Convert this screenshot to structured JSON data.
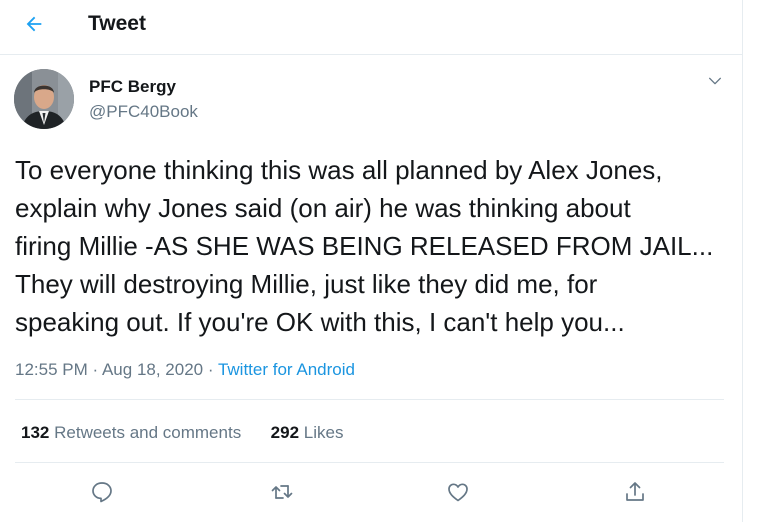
{
  "header": {
    "title": "Tweet"
  },
  "tweet": {
    "author": {
      "name": "PFC Bergy",
      "handle": "@PFC40Book"
    },
    "text_lines": [
      "To everyone thinking this was all planned by Alex Jones,",
      "explain why Jones said (on air) he was thinking about",
      "firing Millie -AS SHE WAS BEING RELEASED FROM JAIL...",
      "They will destroying Millie, just like they did me, for",
      "speaking out. If you're OK with this, I can't help you..."
    ],
    "time": "12:55 PM",
    "separator": "·",
    "date": "Aug 18, 2020",
    "source": "Twitter for Android",
    "stats": {
      "retweets_count": "132",
      "retweets_label": "Retweets and comments",
      "likes_count": "292",
      "likes_label": "Likes"
    }
  },
  "icons": {
    "back": "arrow-left-icon",
    "more": "chevron-down-icon",
    "reply": "speech-bubble-icon",
    "retweet": "retweet-icon",
    "like": "heart-icon",
    "share": "share-upload-icon"
  },
  "colors": {
    "accent": "#1da1f2",
    "link": "#1b95e0",
    "text_primary": "#14171a",
    "text_secondary": "#657786",
    "divider": "#e6ecf0"
  }
}
